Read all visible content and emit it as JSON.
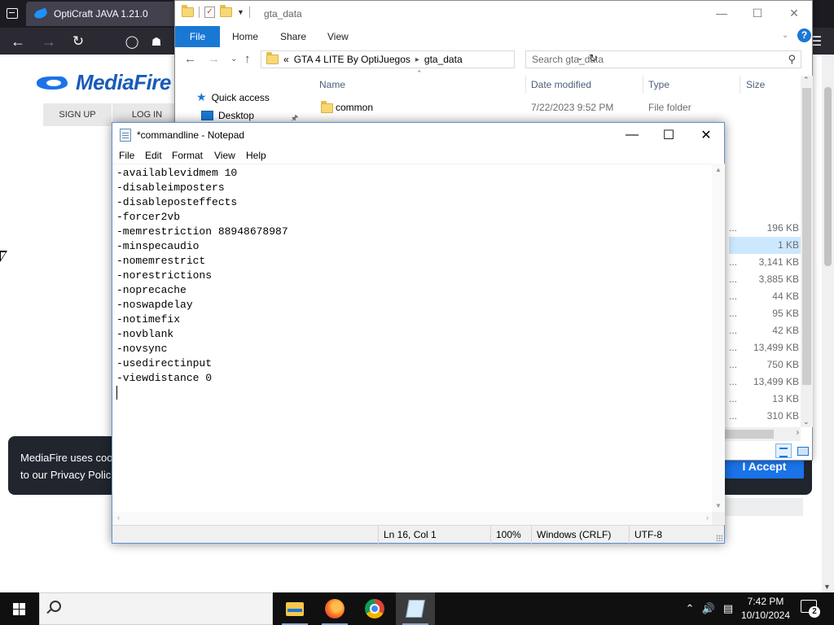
{
  "browser": {
    "tab_title": "OptiCraft JAVA 1.21.0",
    "icons": {
      "back": "back-arrow-icon",
      "forward": "forward-arrow-icon",
      "reload": "reload-icon",
      "shield": "shield-icon",
      "lock": "lock-icon",
      "menu": "hamburger-menu-icon"
    }
  },
  "mediafire": {
    "logo_text": "MediaFire",
    "signup": "SIGN UP",
    "login": "LOG IN",
    "cookie_text": "MediaFire uses coo\nto our Privacy Polic",
    "accept": "I Accept",
    "brand_color": "#1a73e8"
  },
  "explorer": {
    "title": "gta_data",
    "ribbon": {
      "file": "File",
      "home": "Home",
      "share": "Share",
      "view": "View",
      "help": "?"
    },
    "breadcrumb": {
      "prefix": "«",
      "parent": "GTA 4 LITE By OptiJuegos",
      "current": "gta_data"
    },
    "search_placeholder": "Search gta_data",
    "nav_pane": {
      "quick_access": "Quick access",
      "desktop": "Desktop"
    },
    "columns": {
      "name": "Name",
      "date": "Date modified",
      "type": "Type",
      "size": "Size"
    },
    "rows": [
      {
        "name": "common",
        "date": "7/22/2023 9:52 PM",
        "type": "File folder"
      }
    ],
    "sizes": [
      {
        "ellipsis": "...",
        "value": "196 KB"
      },
      {
        "ellipsis": "",
        "value": "1 KB"
      },
      {
        "ellipsis": "...",
        "value": "3,141 KB"
      },
      {
        "ellipsis": "...",
        "value": "3,885 KB"
      },
      {
        "ellipsis": "...",
        "value": "44 KB"
      },
      {
        "ellipsis": "...",
        "value": "95 KB"
      },
      {
        "ellipsis": "...",
        "value": "42 KB"
      },
      {
        "ellipsis": "...",
        "value": "13,499 KB"
      },
      {
        "ellipsis": "...",
        "value": "750 KB"
      },
      {
        "ellipsis": "...",
        "value": "13,499 KB"
      },
      {
        "ellipsis": "...",
        "value": "13 KB"
      },
      {
        "ellipsis": "...",
        "value": "310 KB"
      }
    ]
  },
  "notepad": {
    "title": "*commandline - Notepad",
    "menu": {
      "file": "File",
      "edit": "Edit",
      "format": "Format",
      "view": "View",
      "help": "Help"
    },
    "lines": [
      "-availablevidmem 10",
      "-disableimposters",
      "-disableposteffects",
      "-forcer2vb",
      "-memrestriction 88948678987",
      "-minspecaudio",
      "-nomemrestrict",
      "-norestrictions",
      "-noprecache",
      "-noswapdelay",
      "-notimefix",
      "-novblank",
      "-novsync",
      "-usedirectinput",
      "-viewdistance 0"
    ],
    "status": {
      "position": "Ln 16, Col 1",
      "zoom": "100%",
      "line_endings": "Windows (CRLF)",
      "encoding": "UTF-8"
    }
  },
  "taskbar": {
    "time": "7:42 PM",
    "date": "10/10/2024",
    "notifications": "2",
    "apps": [
      "file-explorer",
      "firefox",
      "chrome",
      "notepad"
    ],
    "tray_icons": [
      "chevron-up-icon",
      "volume-icon",
      "network-icon",
      "keyboard-icon"
    ]
  }
}
